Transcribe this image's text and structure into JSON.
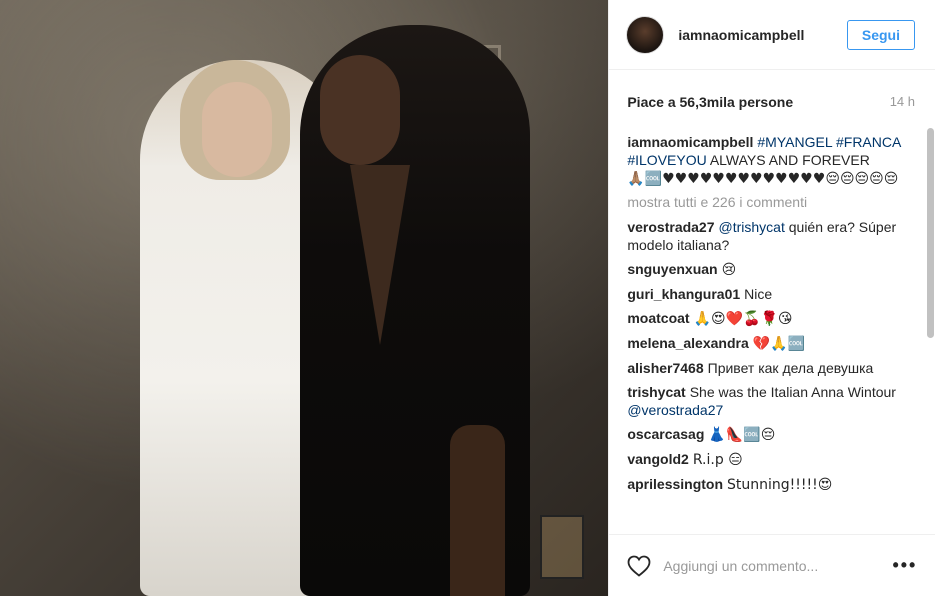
{
  "post": {
    "username": "iamnaomicampbell",
    "follow_label": "Segui",
    "likes": "Piace a 56,3mila persone",
    "time_ago": "14 h",
    "caption": {
      "user": "iamnaomicampbell",
      "tags": "#MYANGEL",
      "line2_tags": "#FRANCA #ILOVEYOU",
      "text": "ALWAYS AND FOREVER",
      "emoji": "🙏🏽🆒♥♥♥♥♥♥♥♥♥♥♥♥♥😔😔😔😔😔"
    },
    "view_all": "mostra tutti e 226 i commenti",
    "comments": [
      {
        "user": "verostrada27",
        "mention": "@trishycat",
        "text": "quién era? Súper modelo italiana?"
      },
      {
        "user": "snguyenxuan",
        "text": "😢"
      },
      {
        "user": "guri_khangura01",
        "text": "Nice"
      },
      {
        "user": "moatcoat",
        "text": "🙏😍❤️🍒🌹😘"
      },
      {
        "user": "melena_alexandra",
        "text": "💔🙏🆒"
      },
      {
        "user": "alisher7468",
        "text": "Привет как дела девушка"
      },
      {
        "user": "trishycat",
        "text": "She was the Italian Anna Wintour",
        "mention_after": "@verostrada27"
      },
      {
        "user": "oscarcasag",
        "text": "👗👠🆒😔"
      },
      {
        "user": "vangold2",
        "text": "R.i.p 😑"
      },
      {
        "user": "aprilessington",
        "text": "Stunning!!!!!😍"
      }
    ],
    "add_comment_placeholder": "Aggiungi un commento...",
    "more_icon": "ellipsis-icon",
    "like_icon": "heart-icon"
  },
  "colors": {
    "accent": "#3897f0",
    "hashtag": "#003569",
    "muted": "#999999"
  }
}
